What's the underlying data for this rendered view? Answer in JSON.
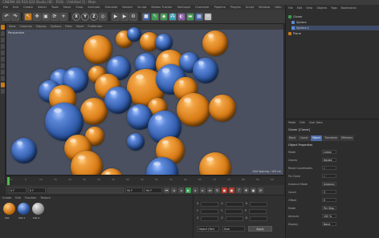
{
  "window": {
    "title": "CINEMA 4D R19.024 Studio (RC - R19) - [Untitled 1] - Main"
  },
  "menubar": [
    "File",
    "Edit",
    "Create",
    "Select",
    "Tools",
    "Mesh",
    "Snap",
    "Animate",
    "Simulate",
    "Render",
    "Sculpt",
    "Motion Tracker",
    "MoGraph",
    "Character",
    "Pipeline",
    "Plugins",
    "Script",
    "Window",
    "Help"
  ],
  "toolbar": {
    "axis_x": "X",
    "axis_y": "Y",
    "axis_z": "Z"
  },
  "viewport": {
    "menu": [
      "View",
      "Cameras",
      "Display",
      "Options",
      "Filter",
      "Panel",
      "ProRender"
    ],
    "label": "Perspective",
    "grid_spacing": "Grid Spacing : 100 cm"
  },
  "timeline": {
    "ticks": [
      "0",
      "5",
      "10",
      "15",
      "20",
      "25",
      "30",
      "35",
      "40",
      "45",
      "50",
      "55",
      "60",
      "65",
      "70",
      "75",
      "80",
      "85",
      "90"
    ],
    "current_frame": "0 F"
  },
  "transport": {
    "start": "0 F",
    "start2": "0 F",
    "end": "90 F",
    "end2": "90 F"
  },
  "materials": {
    "menu": [
      "Create",
      "Edit",
      "Function",
      "Texture"
    ],
    "items": [
      "Mat",
      "Mat.1",
      "Mat.2"
    ]
  },
  "coordinates": {
    "rows": [
      {
        "a": "X",
        "b": "X",
        "c": "H"
      },
      {
        "a": "Y",
        "b": "Y",
        "c": "P"
      },
      {
        "a": "Z",
        "b": "Z",
        "c": "B"
      }
    ],
    "mode": "Object (Rel)",
    "size": "Size",
    "apply": "Apply"
  },
  "objects": {
    "menu": [
      "File",
      "Edit",
      "View",
      "Objects",
      "Tags",
      "Bookmarks"
    ],
    "rows": [
      "Cloner",
      "Sphere",
      "Sphere.1",
      "Plane"
    ]
  },
  "attributes": {
    "menu": [
      "Mode",
      "Edit",
      "User Data"
    ],
    "title": "Cloner [Cloner]",
    "tabs": [
      "Basic",
      "Coord.",
      "Object",
      "Transform",
      "Effectors"
    ],
    "section": "Object Properties",
    "rows": [
      {
        "label": "Mode",
        "value": "Linear"
      },
      {
        "label": "Clones",
        "value": "Iterate"
      },
      {
        "label": "Reset Coordinates",
        "value": "✓"
      },
      {
        "label": "Fix Clone",
        "value": "✓"
      },
      {
        "label": "Instance Mode",
        "value": "Instance"
      },
      {
        "label": "Count",
        "value": "3"
      },
      {
        "label": "Offset",
        "value": "0"
      },
      {
        "label": "Mode",
        "value": "Per Step"
      },
      {
        "label": "Amount",
        "value": "100 %"
      },
      {
        "label": "Display",
        "value": "None"
      }
    ]
  }
}
